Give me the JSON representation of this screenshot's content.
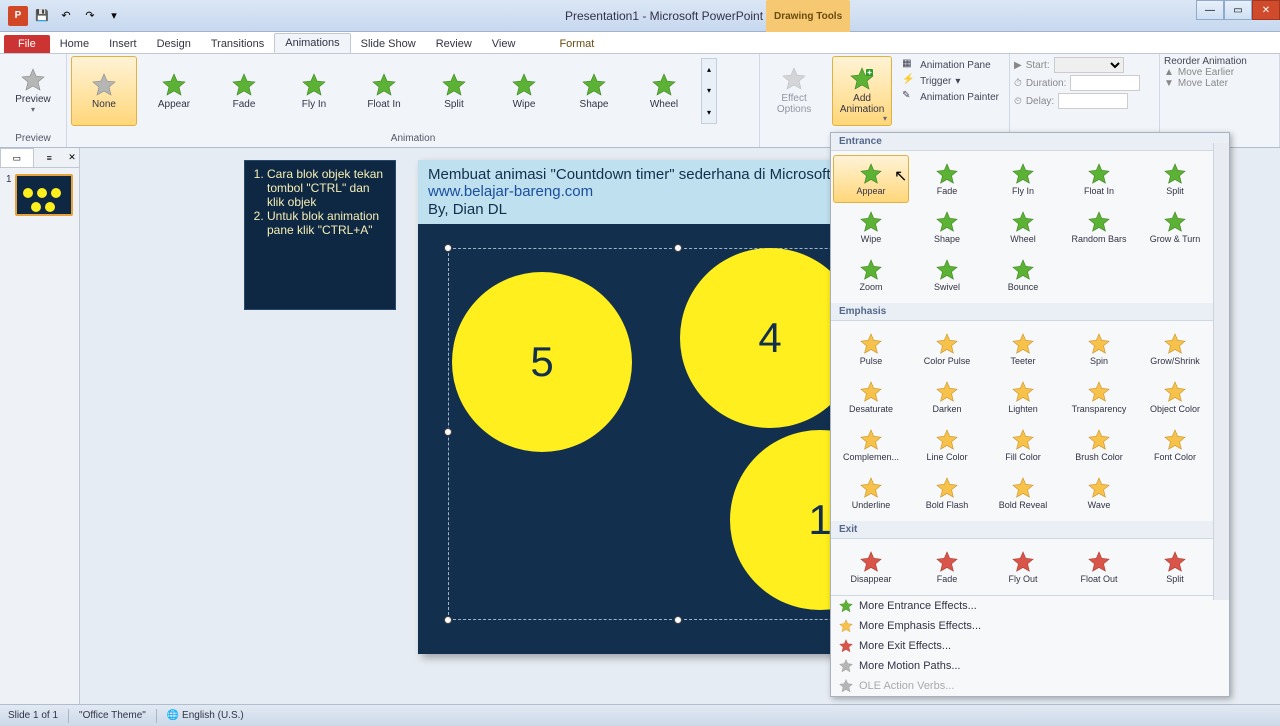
{
  "title": "Presentation1 - Microsoft PowerPoint",
  "contextual_group": "Drawing Tools",
  "tabs": [
    "Home",
    "Insert",
    "Design",
    "Transitions",
    "Animations",
    "Slide Show",
    "Review",
    "View"
  ],
  "active_tab": "Animations",
  "contextual_tab": "Format",
  "file_tab": "File",
  "preview": {
    "label": "Preview",
    "group": "Preview"
  },
  "anim_gallery": [
    "None",
    "Appear",
    "Fade",
    "Fly In",
    "Float In",
    "Split",
    "Wipe",
    "Shape",
    "Wheel"
  ],
  "anim_group_label": "Animation",
  "effect_options": "Effect Options",
  "add_animation": "Add Animation",
  "adv": {
    "pane": "Animation Pane",
    "trigger": "Trigger",
    "painter": "Animation Painter"
  },
  "timing": {
    "start": "Start:",
    "duration": "Duration:",
    "delay": "Delay:"
  },
  "reorder": {
    "title": "Reorder Animation",
    "earlier": "Move Earlier",
    "later": "Move Later"
  },
  "thumbs": {
    "tab1": "",
    "tab2": "",
    "num": "1"
  },
  "notes": {
    "item1": "Cara blok objek tekan tombol \"CTRL\" dan klik objek",
    "item2": "Untuk blok animation pane klik \"CTRL+A\""
  },
  "slide": {
    "title": "Membuat animasi \"Countdown timer\" sederhana di Microsoft P",
    "link": "www.belajar-bareng.com",
    "by": "By, Dian DL",
    "c5": "5",
    "c4": "4",
    "c1": "1"
  },
  "gallery": {
    "entrance_label": "Entrance",
    "entrance": [
      "Appear",
      "Fade",
      "Fly In",
      "Float In",
      "Split",
      "Wipe",
      "Shape",
      "Wheel",
      "Random Bars",
      "Grow & Turn",
      "Zoom",
      "Swivel",
      "Bounce"
    ],
    "emphasis_label": "Emphasis",
    "emphasis": [
      "Pulse",
      "Color Pulse",
      "Teeter",
      "Spin",
      "Grow/Shrink",
      "Desaturate",
      "Darken",
      "Lighten",
      "Transparency",
      "Object Color",
      "Complemen...",
      "Line Color",
      "Fill Color",
      "Brush Color",
      "Font Color",
      "Underline",
      "Bold Flash",
      "Bold Reveal",
      "Wave"
    ],
    "exit_label": "Exit",
    "exit": [
      "Disappear",
      "Fade",
      "Fly Out",
      "Float Out",
      "Split"
    ],
    "more": [
      "More Entrance Effects...",
      "More Emphasis Effects...",
      "More Exit Effects...",
      "More Motion Paths...",
      "OLE Action Verbs..."
    ]
  },
  "status": {
    "slide": "Slide 1 of 1",
    "theme": "\"Office Theme\"",
    "lang": "English (U.S.)"
  }
}
